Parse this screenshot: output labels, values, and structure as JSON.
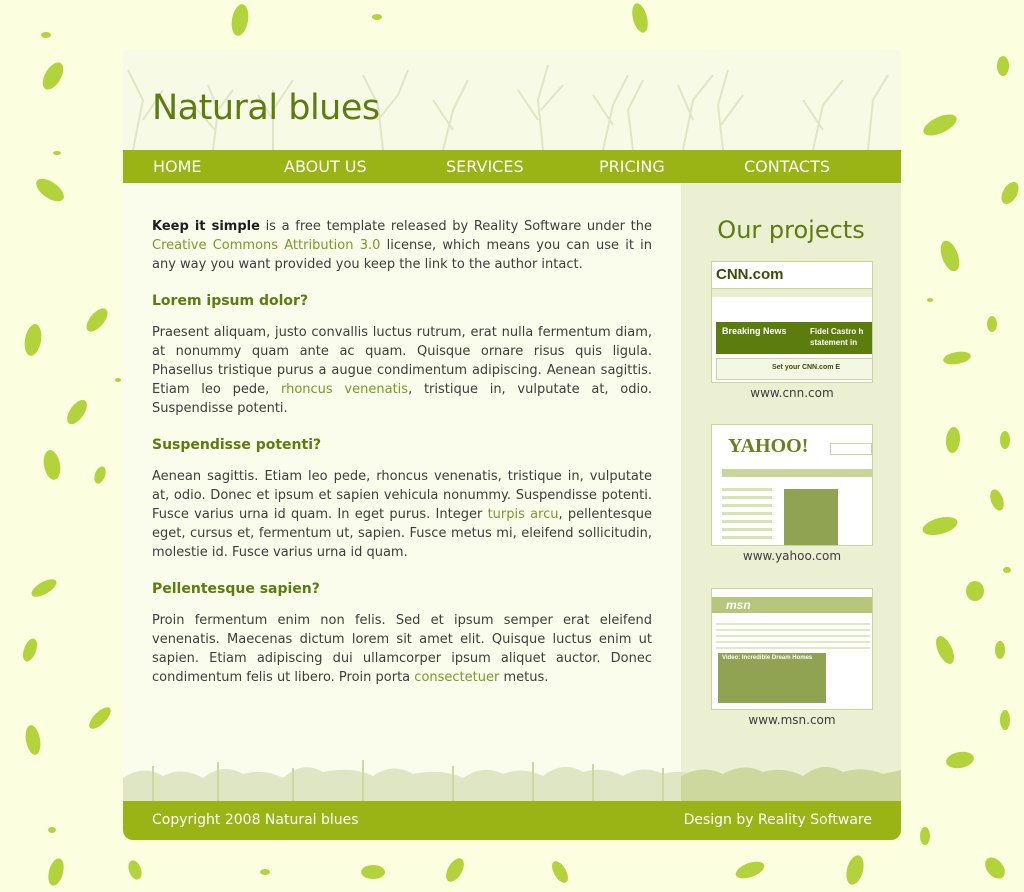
{
  "header": {
    "site_title": "Natural blues"
  },
  "nav": {
    "items": [
      {
        "label": "HOME"
      },
      {
        "label": "ABOUT US"
      },
      {
        "label": "SERVICES"
      },
      {
        "label": "PRICING"
      },
      {
        "label": "CONTACTS"
      }
    ]
  },
  "main": {
    "intro": {
      "lead": "Keep it simple",
      "text1": " is a free template released by Reality Software under the ",
      "link": "Creative Commons Attribution 3.0",
      "text2": " license, which means you can use it in any way you want provided you keep the link to the author intact."
    },
    "sections": [
      {
        "heading": "Lorem ipsum dolor?",
        "text1": "Praesent aliquam, justo convallis luctus rutrum, erat nulla fermentum diam, at nonummy quam ante ac quam. Quisque ornare risus quis ligula. Phasellus tristique purus a augue condimentum adipiscing. Aenean sagittis. Etiam leo pede, ",
        "link": "rhoncus venenatis",
        "text2": ", tristique in, vulputate at, odio. Suspendisse potenti."
      },
      {
        "heading": "Suspendisse potenti?",
        "text1": "Aenean sagittis. Etiam leo pede, rhoncus venenatis, tristique in, vulputate at, odio. Donec et ipsum et sapien vehicula nonummy. Suspendisse potenti. Fusce varius urna id quam. In eget purus. Integer ",
        "link": "turpis arcu",
        "text2": ", pellentesque eget, cursus et, fermentum ut, sapien. Fusce metus mi, eleifend sollicitudin, molestie id. Fusce varius urna id quam."
      },
      {
        "heading": "Pellentesque sapien?",
        "text1": "Proin fermentum enim non felis. Sed et ipsum semper erat eleifend venenatis. Maecenas dictum lorem sit amet elit. Quisque luctus enim ut sapien. Etiam adipiscing dui ullamcorper ipsum aliquet auctor. Donec condimentum felis ut libero. Proin porta ",
        "link": "consectetuer",
        "text2": " metus."
      }
    ]
  },
  "sidebar": {
    "title": "Our projects",
    "projects": [
      {
        "caption": "www.cnn.com",
        "logo": "CNN.com",
        "banner": "Breaking News",
        "headline": "Fidel Castro h statement in",
        "footer_text": "Set your CNN.com E"
      },
      {
        "caption": "www.yahoo.com",
        "logo": "YAHOO!"
      },
      {
        "caption": "www.msn.com",
        "logo": "msn",
        "banner": "Video: Incredible Dream Homes"
      }
    ]
  },
  "footer": {
    "copyright": "Copyright 2008 Natural blues",
    "design": "Design by Reality Software"
  },
  "colors": {
    "background": "#fcffdf",
    "nav_bar": "#99b414",
    "title_green": "#5c7c0d",
    "link_green": "#7a9a2a",
    "sidebar_bg": "#ebf0d3"
  }
}
